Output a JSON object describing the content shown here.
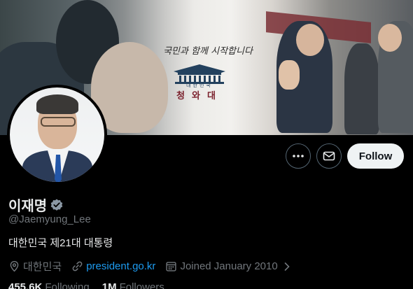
{
  "banner": {
    "slogan": "국민과 함께 시작합니다",
    "subtitle": "대한민국",
    "name": "청와대"
  },
  "profile": {
    "display_name": "이재명",
    "handle": "@Jaemyung_Lee",
    "bio": "대한민국 제21대 대통령",
    "location": "대한민국",
    "website": "president.go.kr",
    "joined": "Joined January 2010",
    "verified": true,
    "verified_badge_color": "#8b98a5"
  },
  "actions": {
    "more_icon": "more-icon",
    "message_icon": "envelope-icon",
    "follow_label": "Follow"
  },
  "stats": {
    "following_count": "455.6K",
    "following_label": "Following",
    "followers_count": "1M",
    "followers_label": "Followers"
  },
  "colors": {
    "background": "#000000",
    "accent_link": "#1d9bf0",
    "secondary_text": "#71767b",
    "follow_button_bg": "#eff3f4"
  }
}
